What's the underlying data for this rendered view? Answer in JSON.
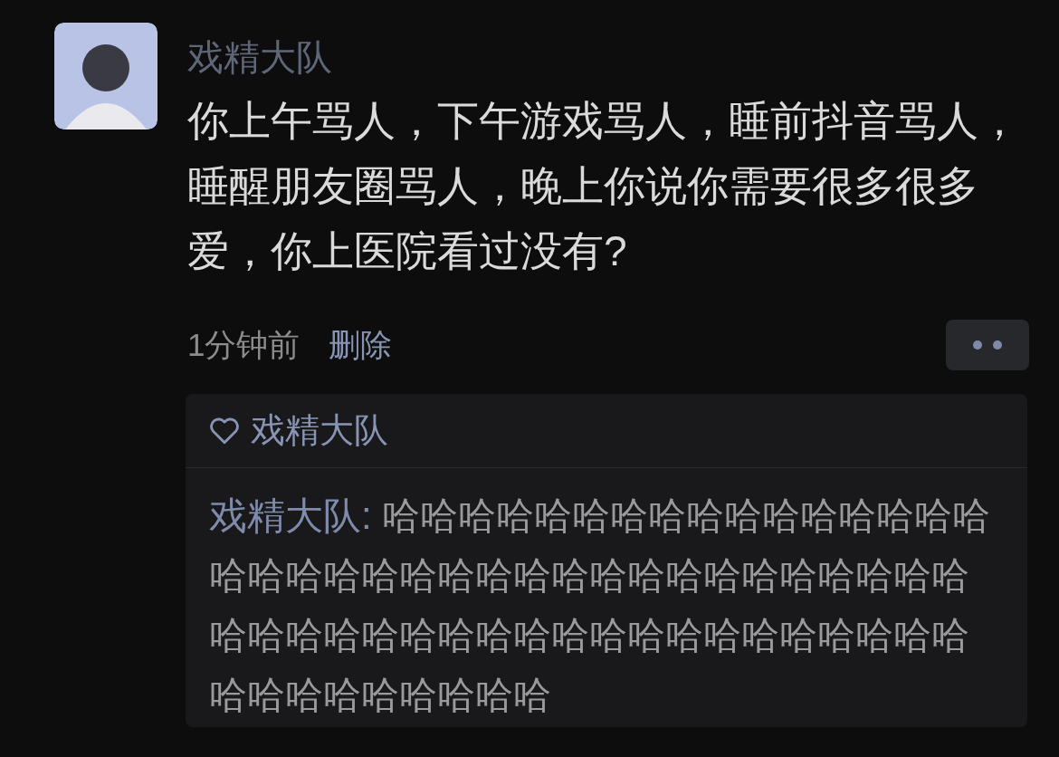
{
  "comment": {
    "author": "戏精大队",
    "text": "你上午骂人，下午游戏骂人，睡前抖音骂人，睡醒朋友圈骂人，晚上你说你需要很多很多爱，你上医院看过没有?",
    "time": "1分钟前",
    "delete_label": "删除"
  },
  "reply_box": {
    "title": "戏精大队",
    "reply_author": "戏精大队:",
    "reply_text": "哈哈哈哈哈哈哈哈哈哈哈哈哈哈哈哈哈哈哈哈哈哈哈哈哈哈哈哈哈哈哈哈哈哈哈哈哈哈哈哈哈哈哈哈哈哈哈哈哈哈哈哈哈哈哈哈哈哈哈哈哈哈哈哈哈"
  }
}
